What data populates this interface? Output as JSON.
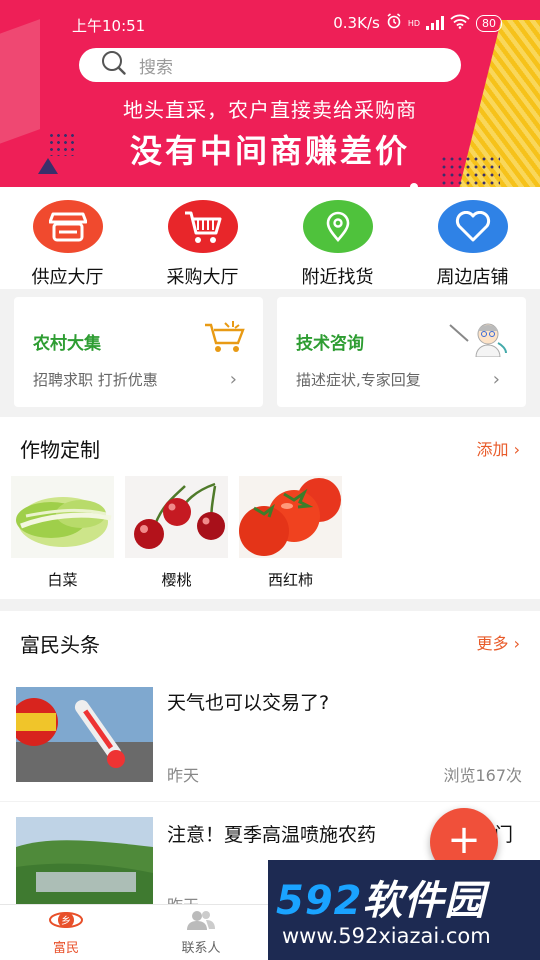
{
  "status_bar": {
    "time": "上午10:51",
    "speed": "0.3K/s",
    "network": "HD",
    "battery": "80"
  },
  "search": {
    "placeholder": "搜索"
  },
  "banner": {
    "line1": "地头直采，农户直接卖给采购商",
    "line2": "没有中间商赚差价"
  },
  "quick_nav": [
    {
      "label": "供应大厅",
      "icon": "shop-icon",
      "color": "#f04a2e"
    },
    {
      "label": "采购大厅",
      "icon": "cart-icon",
      "color": "#e8262a"
    },
    {
      "label": "附近找货",
      "icon": "location-icon",
      "color": "#4fc23c"
    },
    {
      "label": "周边店铺",
      "icon": "heart-icon",
      "color": "#2f82e6"
    }
  ],
  "cards": [
    {
      "title": "农村大集",
      "subtitle": "招聘求职 打折优惠",
      "icon": "cart-basket-icon"
    },
    {
      "title": "技术咨询",
      "subtitle": "描述症状,专家回复",
      "icon": "doctor-icon"
    }
  ],
  "crops_section": {
    "title": "作物定制",
    "action": "添加",
    "items": [
      {
        "label": "白菜",
        "icon": "cabbage-image"
      },
      {
        "label": "樱桃",
        "icon": "cherry-image"
      },
      {
        "label": "西红柿",
        "icon": "tomato-image"
      }
    ]
  },
  "news_section": {
    "title": "富民头条",
    "action": "更多",
    "items": [
      {
        "title": "天气也可以交易了?",
        "date": "昨天",
        "views": "浏览167次"
      },
      {
        "title": "注意！夏季高温喷施农药",
        "title_tail": "门",
        "date": "昨天",
        "views": ""
      }
    ]
  },
  "fab": {
    "label": "+"
  },
  "tabbar": [
    {
      "label": "富民",
      "active": true
    },
    {
      "label": "联系人",
      "active": false
    }
  ],
  "watermark": {
    "brand_num": "592",
    "brand_cn": "软件园",
    "url": "www.592xiazai.com"
  },
  "colors": {
    "brand_red": "#ee1f57",
    "accent_orange": "#e85b2a",
    "green": "#2e9d32"
  }
}
